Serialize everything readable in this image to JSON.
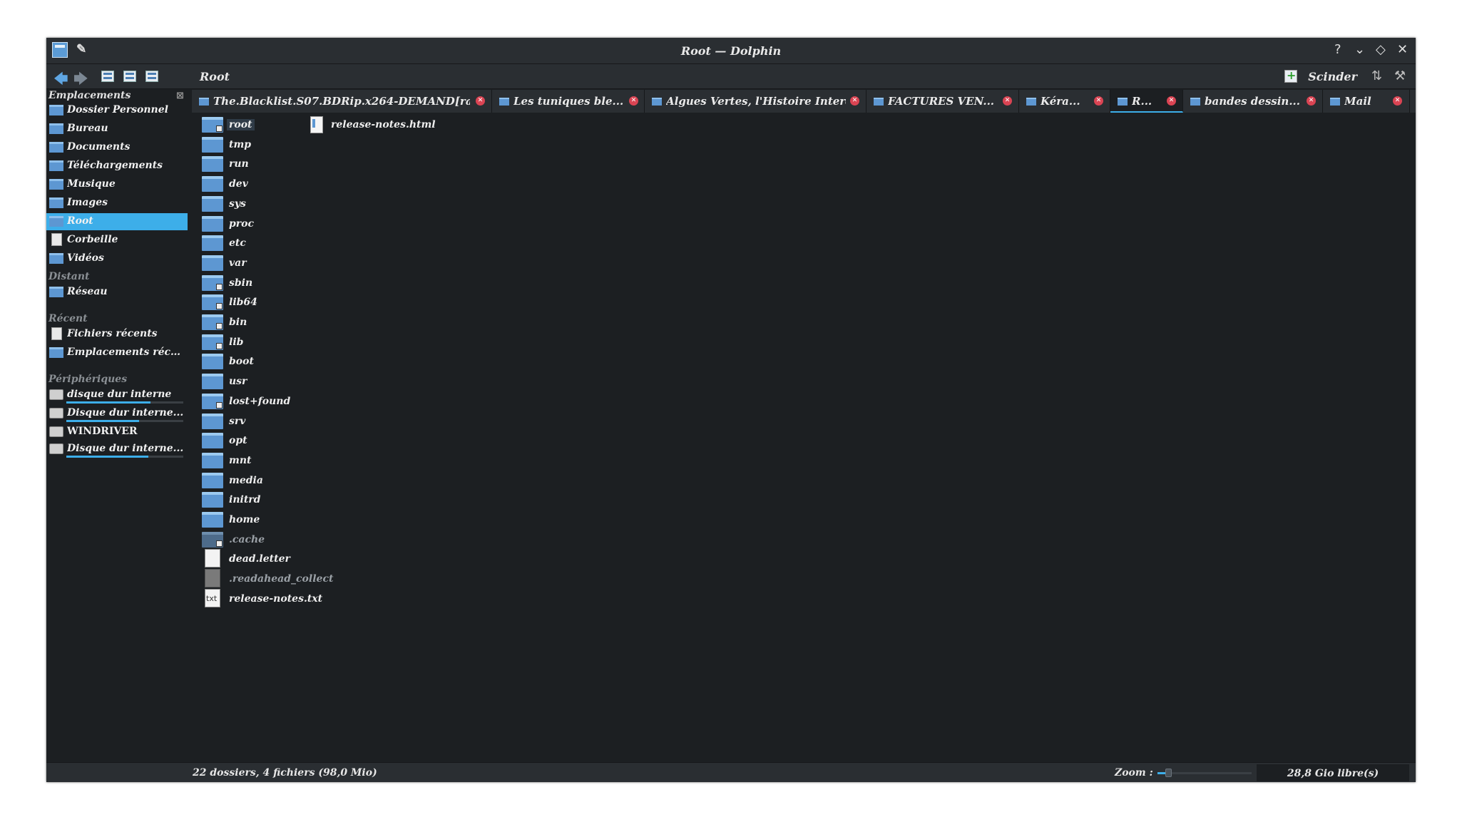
{
  "window": {
    "title": "Root — Dolphin"
  },
  "toolbar": {
    "breadcrumb": "Root",
    "split_label": "Scinder"
  },
  "sidebar": {
    "places_header": "Emplacements",
    "places": [
      {
        "label": "Dossier Personnel",
        "icon": "home-folder-icon"
      },
      {
        "label": "Bureau",
        "icon": "desktop-icon"
      },
      {
        "label": "Documents",
        "icon": "documents-folder-icon"
      },
      {
        "label": "Téléchargements",
        "icon": "downloads-folder-icon"
      },
      {
        "label": "Musique",
        "icon": "music-folder-icon"
      },
      {
        "label": "Images",
        "icon": "pictures-folder-icon"
      },
      {
        "label": "Root",
        "icon": "root-folder-icon",
        "selected": true
      },
      {
        "label": "Corbeille",
        "icon": "trash-icon"
      },
      {
        "label": "Vidéos",
        "icon": "videos-folder-icon"
      }
    ],
    "remote_header": "Distant",
    "remote": [
      {
        "label": "Réseau",
        "icon": "network-folder-icon"
      }
    ],
    "recent_header": "Récent",
    "recent": [
      {
        "label": "Fichiers récents",
        "icon": "recent-files-icon"
      },
      {
        "label": "Emplacements réce...",
        "icon": "recent-places-icon"
      }
    ],
    "devices_header": "Périphériques",
    "devices": [
      {
        "label": "disque dur interne",
        "usage": 0.72
      },
      {
        "label": "Disque dur interne...",
        "usage": 0.62
      },
      {
        "label": "WINDRIVER",
        "usage": null
      },
      {
        "label": "Disque dur interne...",
        "usage": 0.7
      }
    ]
  },
  "tabs": [
    {
      "label": "The.Blacklist.S07.BDRip.x264-DEMAND[rar..."
    },
    {
      "label": "Les tuniques ble..."
    },
    {
      "label": "Algues Vertes, l'Histoire Interd..."
    },
    {
      "label": "FACTURES VEN..."
    },
    {
      "label": "Kéra..."
    },
    {
      "label": "R...",
      "active": true
    },
    {
      "label": "bandes dessin..."
    },
    {
      "label": "Mail"
    }
  ],
  "files_col1": [
    {
      "name": "root",
      "type": "folder",
      "badge": true,
      "current": true
    },
    {
      "name": "tmp",
      "type": "folder-temp"
    },
    {
      "name": "run",
      "type": "folder"
    },
    {
      "name": "dev",
      "type": "folder"
    },
    {
      "name": "sys",
      "type": "folder"
    },
    {
      "name": "proc",
      "type": "folder"
    },
    {
      "name": "etc",
      "type": "folder"
    },
    {
      "name": "var",
      "type": "folder"
    },
    {
      "name": "sbin",
      "type": "folder",
      "badge": true
    },
    {
      "name": "lib64",
      "type": "folder",
      "badge": true
    },
    {
      "name": "bin",
      "type": "folder",
      "badge": true
    },
    {
      "name": "lib",
      "type": "folder",
      "badge": true
    },
    {
      "name": "boot",
      "type": "folder"
    },
    {
      "name": "usr",
      "type": "folder"
    },
    {
      "name": "lost+found",
      "type": "folder",
      "badge": true
    },
    {
      "name": "srv",
      "type": "folder"
    },
    {
      "name": "opt",
      "type": "folder"
    },
    {
      "name": "mnt",
      "type": "folder"
    },
    {
      "name": "media",
      "type": "folder"
    },
    {
      "name": "initrd",
      "type": "folder"
    },
    {
      "name": "home",
      "type": "folder"
    },
    {
      "name": ".cache",
      "type": "folder",
      "hidden": true,
      "badge": true
    },
    {
      "name": "dead.letter",
      "type": "file"
    },
    {
      "name": ".readahead_collect",
      "type": "file-grey",
      "hidden": true
    },
    {
      "name": "release-notes.txt",
      "type": "txt",
      "glyph": "txt"
    }
  ],
  "files_col2": [
    {
      "name": "release-notes.html",
      "type": "html"
    }
  ],
  "statusbar": {
    "summary": "22 dossiers, 4 fichiers (98,0 Mio)",
    "zoom_label": "Zoom :",
    "zoom_level": 0.1,
    "free_space": "28,8 Gio libre(s)"
  },
  "colors": {
    "accent": "#3daee9",
    "folder": "#5d97d2",
    "close_badge": "#da4453"
  }
}
